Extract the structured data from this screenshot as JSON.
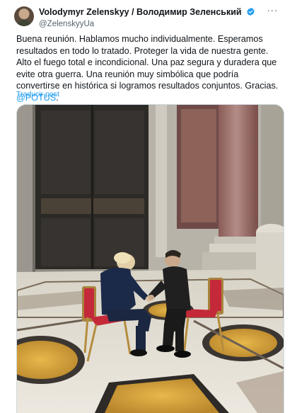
{
  "post": {
    "author_name": "Volodymyr Zelenskyy / Володимир Зеленський",
    "author_handle": "@ZelenskyyUa",
    "text_main": "Buena reunión. Hablamos mucho individualmente. Esperamos resultados en todo lo tratado. Proteger la vida de nuestra gente. Alto el fuego total e incondicional. Una paz segura y duradera que evite otra guerra. Una reunión muy simbólica que podría convertirse en histórica si logramos resultados conjuntos. Gracias. ",
    "mention": "@POTUS",
    "text_end": ".",
    "translate_label": "Traducir post",
    "more_label": "···"
  },
  "colors": {
    "accent": "#1d9bf0",
    "text": "#0f1419",
    "secondary": "#536471"
  },
  "icons": {
    "verified": "verified-badge-icon",
    "more": "more-options-icon"
  }
}
